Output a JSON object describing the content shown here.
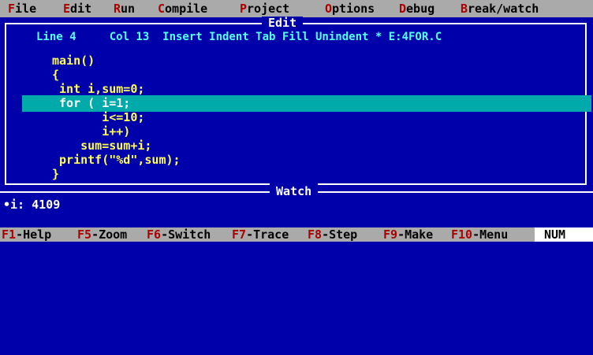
{
  "menu": [
    {
      "hk": "F",
      "rest": "ile"
    },
    {
      "hk": "E",
      "rest": "dit"
    },
    {
      "hk": "R",
      "rest": "un"
    },
    {
      "hk": "C",
      "rest": "ompile"
    },
    {
      "hk": "P",
      "rest": "roject"
    },
    {
      "hk": "O",
      "rest": "ptions"
    },
    {
      "hk": "D",
      "rest": "ebug"
    },
    {
      "hk": "B",
      "rest": "reak/watch"
    }
  ],
  "editor": {
    "title": "Edit",
    "status": "Line 4     Col 13  Insert Indent Tab Fill Unindent * E:4FOR.C",
    "lines": [
      "main()",
      "{",
      " int i,sum=0;",
      " for ( i=1;",
      "       i<=10;",
      "       i++)",
      "    sum=sum+i;",
      " printf(\"%d\",sum);",
      "}"
    ]
  },
  "watch": {
    "title": "Watch",
    "entry": "•i: 4109"
  },
  "keys": [
    {
      "fk": "F1",
      "label": "-Help"
    },
    {
      "fk": "F5",
      "label": "-Zoom"
    },
    {
      "fk": "F6",
      "label": "-Switch"
    },
    {
      "fk": "F7",
      "label": "-Trace"
    },
    {
      "fk": "F8",
      "label": "-Step"
    },
    {
      "fk": "F9",
      "label": "-Make"
    },
    {
      "fk": "F10",
      "label": "-Menu"
    }
  ],
  "num_indicator": "NUM",
  "colors": {
    "background": "#0000aa",
    "menu_bg": "#aaaaaa",
    "hotkey": "#aa0000",
    "code_text": "#ffff55",
    "status_text": "#55ffff",
    "highlight_bar": "#00aaaa"
  }
}
